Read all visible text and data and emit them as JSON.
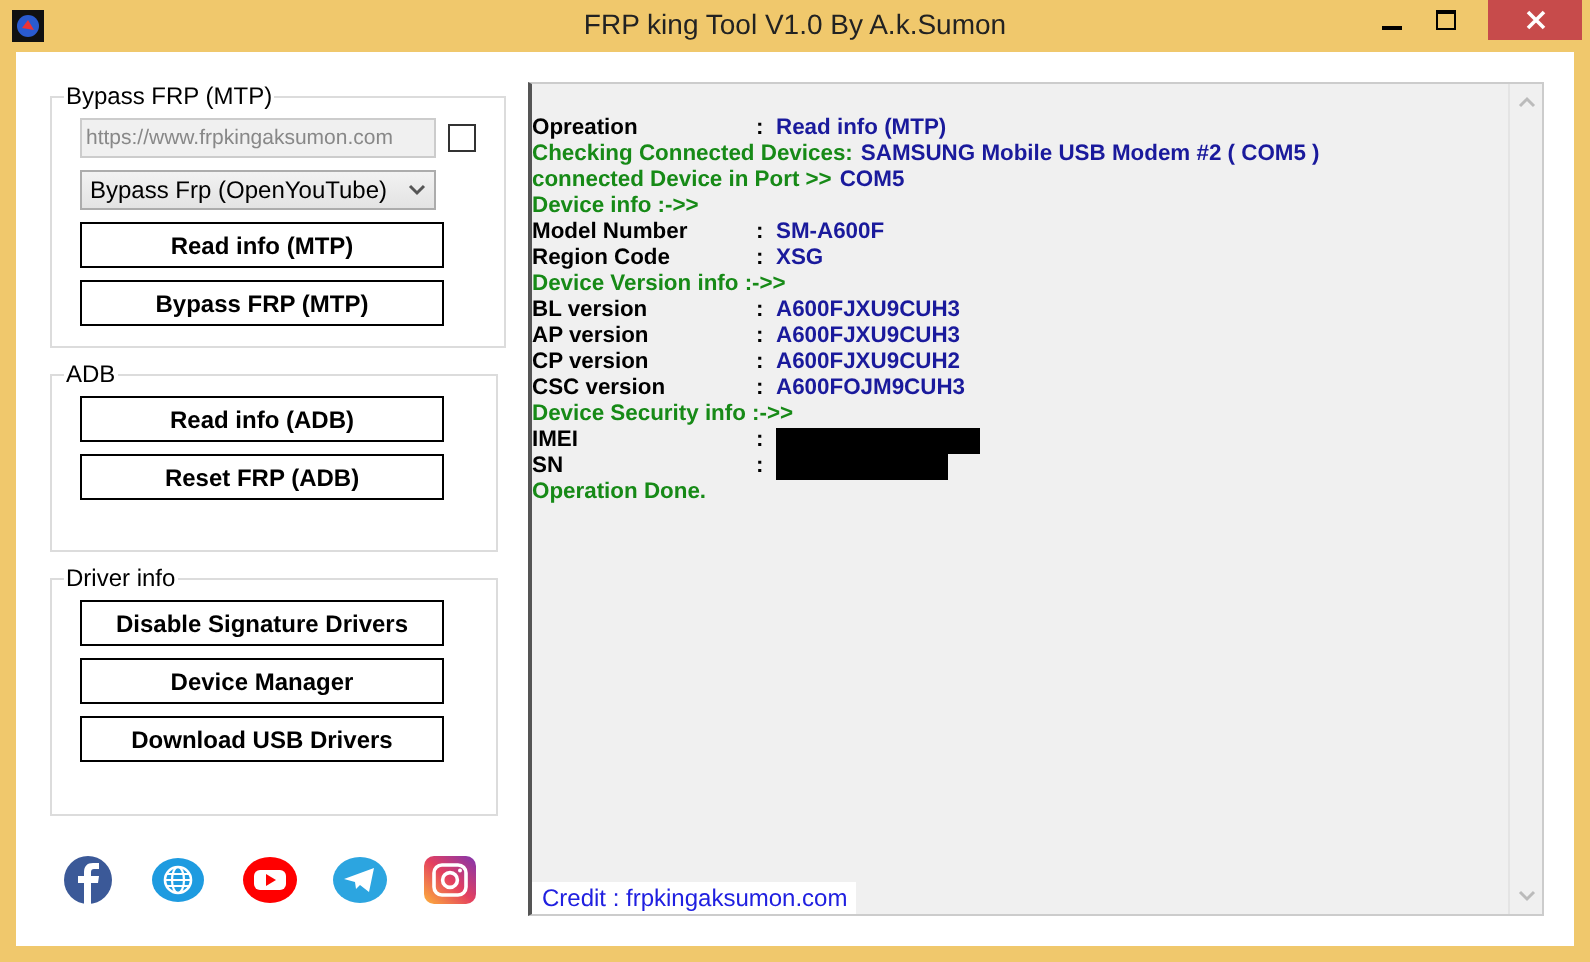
{
  "window": {
    "title": "FRP king Tool V1.0 By A.k.Sumon"
  },
  "groups": [
    {
      "title": "Bypass FRP (MTP)",
      "url_field": {
        "value": "https://www.frpkingaksumon.com",
        "disabled": true
      },
      "checkbox": {
        "checked": false
      },
      "dropdown": {
        "value": "Bypass Frp (OpenYouTube)"
      },
      "buttons": [
        "Read info (MTP)",
        "Bypass FRP (MTP)"
      ]
    },
    {
      "title": "ADB",
      "buttons": [
        "Read info (ADB)",
        "Reset FRP (ADB)"
      ]
    },
    {
      "title": "Driver info",
      "buttons": [
        "Disable Signature Drivers",
        "Device Manager",
        "Download USB Drivers"
      ]
    }
  ],
  "social": [
    {
      "kind": "facebook"
    },
    {
      "kind": "web"
    },
    {
      "kind": "youtube"
    },
    {
      "kind": "telegram"
    },
    {
      "kind": "instagram"
    }
  ],
  "log": [
    {
      "kind": "pair",
      "label": "Opreation",
      "colon": ":",
      "value": "Read info (MTP)"
    },
    {
      "kind": "status",
      "text": "Checking Connected Devices:",
      "value": "SAMSUNG Mobile USB Modem #2 ( COM5 )"
    },
    {
      "kind": "status",
      "text": "connected Device in Port >>",
      "value": "COM5"
    },
    {
      "kind": "status",
      "text": "Device info :->>"
    },
    {
      "kind": "pair",
      "label": "Model Number",
      "colon": ":",
      "value": "SM-A600F"
    },
    {
      "kind": "pair",
      "label": "Region Code",
      "colon": ":",
      "value": "XSG"
    },
    {
      "kind": "status",
      "text": "Device Version info :->>"
    },
    {
      "kind": "pair",
      "label": "BL version",
      "colon": ":",
      "value": "A600FJXU9CUH3"
    },
    {
      "kind": "pair",
      "label": "AP version",
      "colon": ":",
      "value": "A600FJXU9CUH3"
    },
    {
      "kind": "pair",
      "label": "CP version",
      "colon": ":",
      "value": "A600FJXU9CUH2"
    },
    {
      "kind": "pair",
      "label": "CSC version",
      "colon": ":",
      "value": "A600FOJM9CUH3"
    },
    {
      "kind": "status",
      "text": "Device Security info :->>"
    },
    {
      "kind": "redacted",
      "label": "IMEI",
      "colon": ":"
    },
    {
      "kind": "redacted",
      "label": "SN",
      "colon": ":"
    },
    {
      "kind": "status",
      "text": "Operation Done."
    }
  ],
  "credit": "Credit : frpkingaksumon.com"
}
